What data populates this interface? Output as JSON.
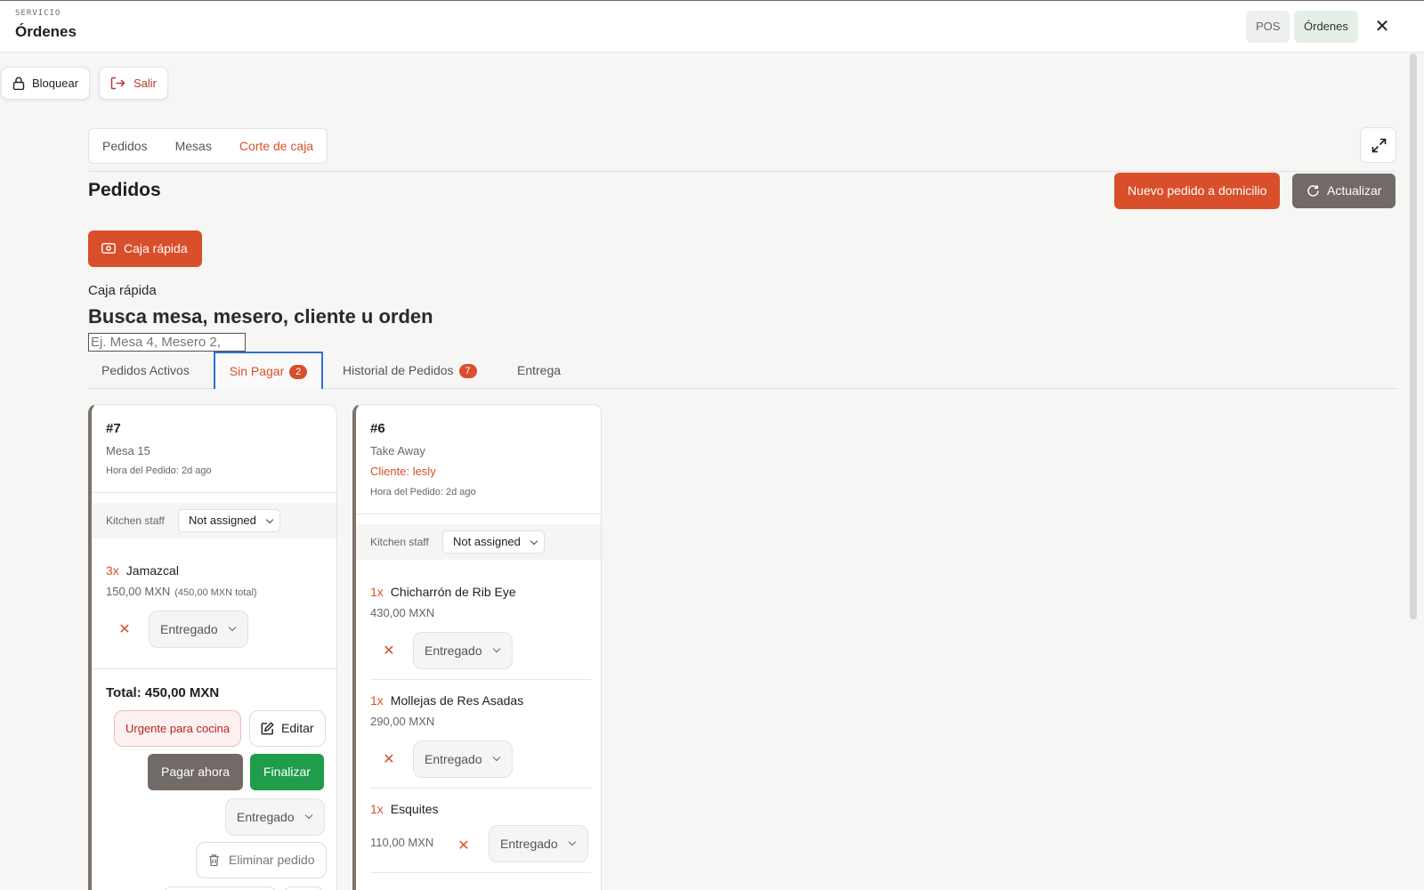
{
  "header": {
    "section": "SERVICIO",
    "title": "Órdenes",
    "pos_label": "POS",
    "orders_label": "Órdenes",
    "close_icon": "close-icon"
  },
  "actions": {
    "lock_label": "Bloquear",
    "exit_label": "Salir"
  },
  "topnav": {
    "items": [
      "Pedidos",
      "Mesas",
      "Corte de caja"
    ],
    "active": "Corte de caja"
  },
  "page": {
    "title": "Pedidos",
    "new_delivery_label": "Nuevo pedido a domicilio",
    "refresh_label": "Actualizar"
  },
  "caja": {
    "button_label": "Caja rápida",
    "label": "Caja rápida",
    "heading": "Busca mesa, mesero, cliente u orden",
    "placeholder": "Ej. Mesa 4, Mesero 2,"
  },
  "tabs": [
    {
      "label": "Pedidos Activos"
    },
    {
      "label": "Sin Pagar",
      "badge": "2",
      "active": true
    },
    {
      "label": "Historial de Pedidos",
      "badge": "7"
    },
    {
      "label": "Entrega"
    }
  ],
  "orders": [
    {
      "number": "#7",
      "location": "Mesa 15",
      "time": "Hora del Pedido: 2d ago",
      "staff_label": "Kitchen staff",
      "staff_value": "Not assigned",
      "items": [
        {
          "qty": "3x",
          "name": "Jamazcal",
          "price": "150,00 MXN",
          "line_total": "(450,00 MXN total)",
          "status": "Entregado"
        }
      ],
      "total": "Total: 450,00 MXN",
      "urgent_label": "Urgente para cocina",
      "edit_label": "Editar",
      "pay_label": "Pagar ahora",
      "finish_label": "Finalizar",
      "order_status": "Entregado",
      "delete_label": "Eliminar pedido"
    },
    {
      "number": "#6",
      "location": "Take Away",
      "client": "Cliente: lesly",
      "time": "Hora del Pedido: 2d ago",
      "staff_label": "Kitchen staff",
      "staff_value": "Not assigned",
      "items": [
        {
          "qty": "1x",
          "name": "Chicharrón de Rib Eye",
          "price": "430,00 MXN",
          "status": "Entregado"
        },
        {
          "qty": "1x",
          "name": "Mollejas de Res Asadas",
          "price": "290,00 MXN",
          "status": "Entregado"
        },
        {
          "qty": "1x",
          "name": "Esquites",
          "price": "110,00 MXN",
          "status": "Entregado"
        }
      ]
    }
  ],
  "colors": {
    "accent": "#d94f2b",
    "success": "#1f9d4a",
    "neutral_button": "#716a66",
    "tab_focus": "#2f6fd1"
  }
}
